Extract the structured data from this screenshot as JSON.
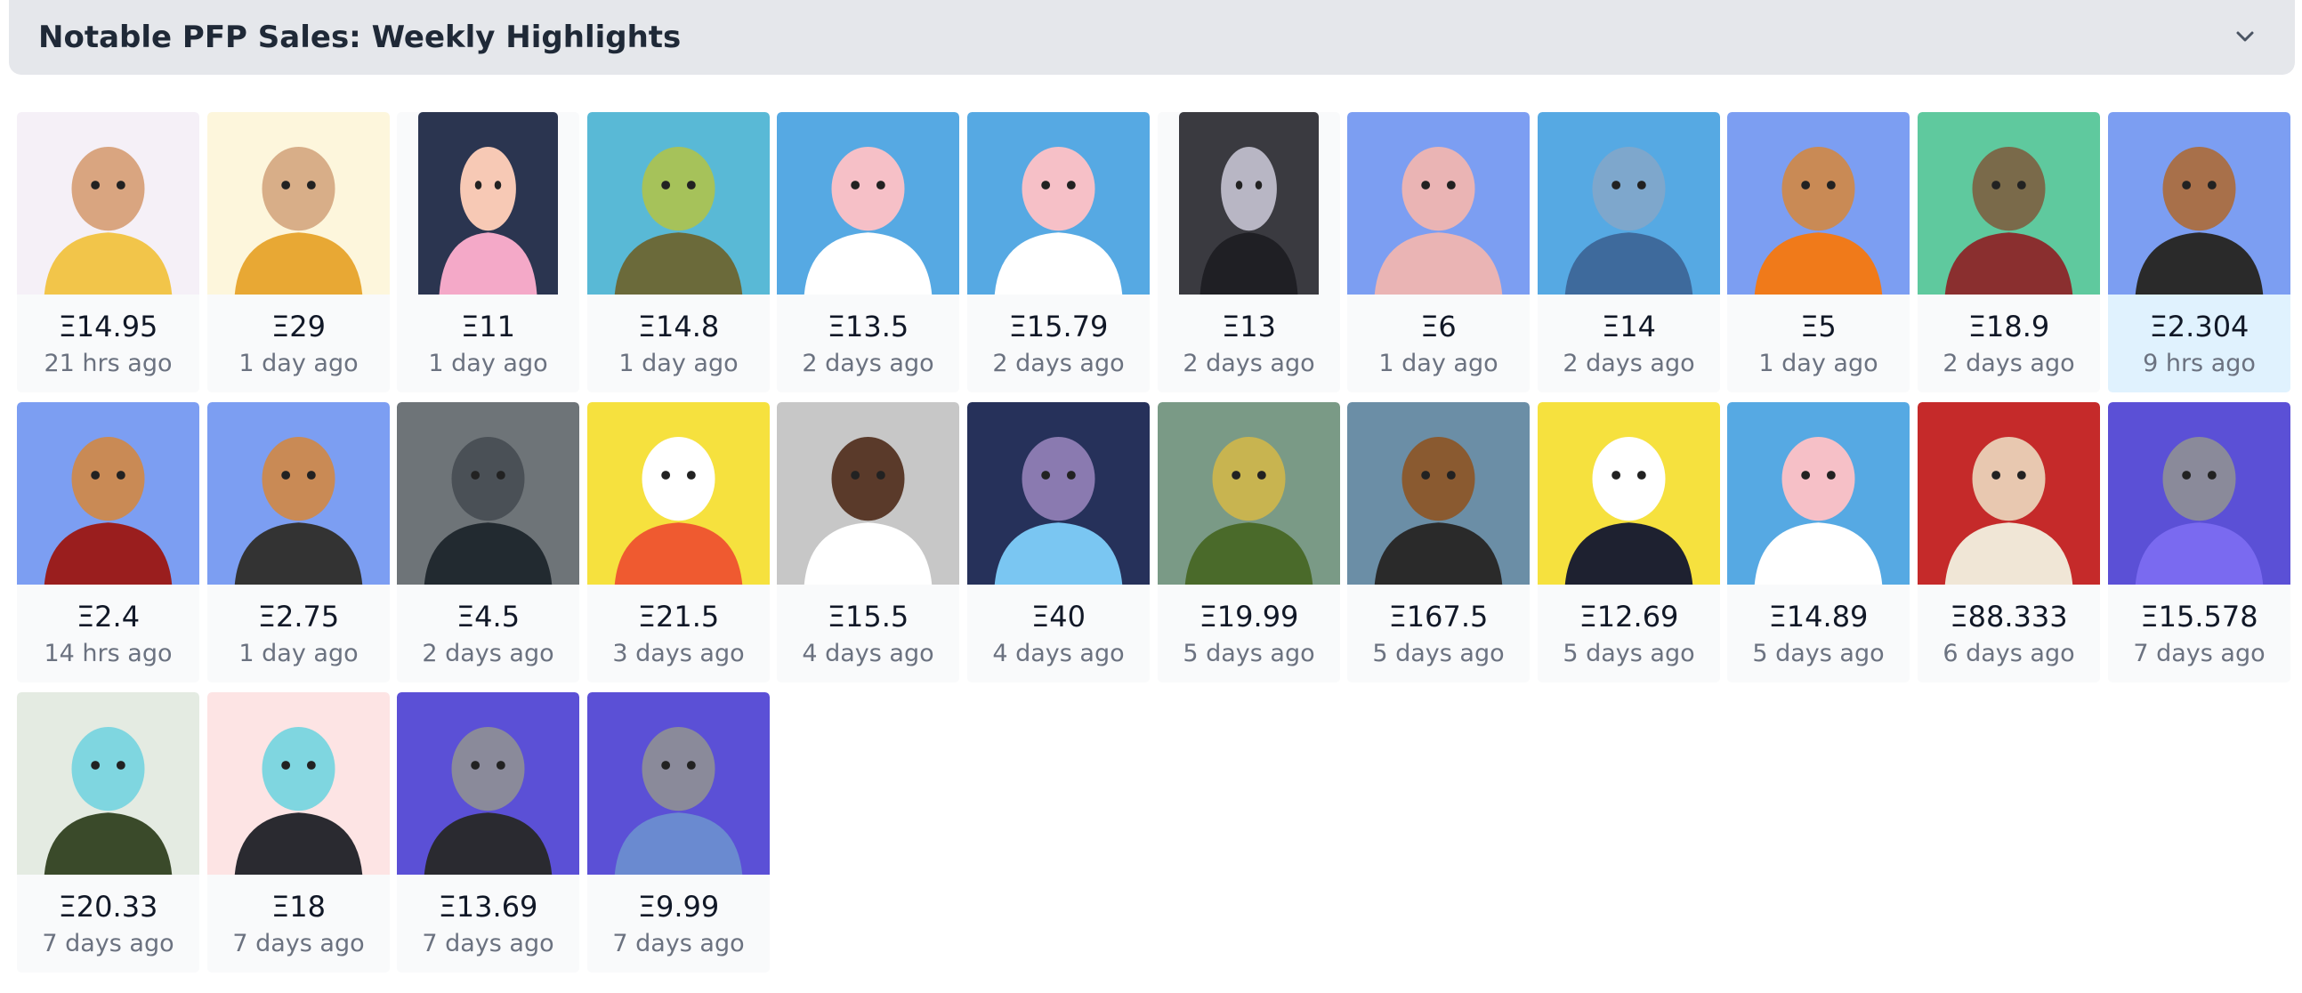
{
  "header": {
    "title": "Notable PFP Sales: Weekly Highlights",
    "toggle_icon": "chevron-down-icon"
  },
  "sales": [
    {
      "price": "Ξ14.95",
      "time": "21 hrs ago",
      "bg": "#f5f0f7",
      "figure": "#f2c54a",
      "skin": "#d9a580"
    },
    {
      "price": "Ξ29",
      "time": "1 day ago",
      "bg": "#fdf6dc",
      "figure": "#e8a834",
      "skin": "#d8ae88"
    },
    {
      "price": "Ξ11",
      "time": "1 day ago",
      "bg": "#2b3550",
      "figure": "#f4a9c8",
      "skin": "#f7c9b5"
    },
    {
      "price": "Ξ14.8",
      "time": "1 day ago",
      "bg": "#59b9d6",
      "figure": "#6b6a3a",
      "skin": "#a6c25a"
    },
    {
      "price": "Ξ13.5",
      "time": "2 days ago",
      "bg": "#56a9e3",
      "figure": "#ffffff",
      "skin": "#f6c0c7"
    },
    {
      "price": "Ξ15.79",
      "time": "2 days ago",
      "bg": "#56a9e3",
      "figure": "#ffffff",
      "skin": "#f6c0c7"
    },
    {
      "price": "Ξ13",
      "time": "2 days ago",
      "bg": "#3a3a40",
      "figure": "#1f1f24",
      "skin": "#b8b6c4"
    },
    {
      "price": "Ξ6",
      "time": "1 day ago",
      "bg": "#7c9ef2",
      "figure": "#eab4b4",
      "skin": "#eab4b4"
    },
    {
      "price": "Ξ14",
      "time": "2 days ago",
      "bg": "#56a9e3",
      "figure": "#3e6a9c",
      "skin": "#7ea7cc"
    },
    {
      "price": "Ξ5",
      "time": "1 day ago",
      "bg": "#7c9ef2",
      "figure": "#f07a1a",
      "skin": "#c98a55"
    },
    {
      "price": "Ξ18.9",
      "time": "2 days ago",
      "bg": "#5fc99e",
      "figure": "#8a2f2f",
      "skin": "#7a6a4a"
    },
    {
      "price": "Ξ2.304",
      "time": "9 hrs ago",
      "bg": "#7c9ef2",
      "figure": "#2a2a2a",
      "skin": "#a8704a"
    },
    {
      "price": "Ξ2.4",
      "time": "14 hrs ago",
      "bg": "#7c9ef2",
      "figure": "#9a1e1e",
      "skin": "#c98a55"
    },
    {
      "price": "Ξ2.75",
      "time": "1 day ago",
      "bg": "#7c9ef2",
      "figure": "#333333",
      "skin": "#c98a55"
    },
    {
      "price": "Ξ4.5",
      "time": "2 days ago",
      "bg": "#6e7478",
      "figure": "#222a30",
      "skin": "#4a5056"
    },
    {
      "price": "Ξ21.5",
      "time": "3 days ago",
      "bg": "#f6e13e",
      "figure": "#ef5a30",
      "skin": "#ffffff"
    },
    {
      "price": "Ξ15.5",
      "time": "4 days ago",
      "bg": "#c7c7c7",
      "figure": "#ffffff",
      "skin": "#5a3a2a"
    },
    {
      "price": "Ξ40",
      "time": "4 days ago",
      "bg": "#26315a",
      "figure": "#7ac6f2",
      "skin": "#8a7ab0"
    },
    {
      "price": "Ξ19.99",
      "time": "5 days ago",
      "bg": "#7a9a86",
      "figure": "#4a6a2a",
      "skin": "#c8b450"
    },
    {
      "price": "Ξ167.5",
      "time": "5 days ago",
      "bg": "#6b8ea6",
      "figure": "#2a2a2a",
      "skin": "#8a5a30"
    },
    {
      "price": "Ξ12.69",
      "time": "5 days ago",
      "bg": "#f6e13e",
      "figure": "#1e2130",
      "skin": "#ffffff"
    },
    {
      "price": "Ξ14.89",
      "time": "5 days ago",
      "bg": "#56a9e3",
      "figure": "#ffffff",
      "skin": "#f6c0c7"
    },
    {
      "price": "Ξ88.333",
      "time": "6 days ago",
      "bg": "#c52a2a",
      "figure": "#f0e6d6",
      "skin": "#e8c8b0"
    },
    {
      "price": "Ξ15.578",
      "time": "7 days ago",
      "bg": "#5b50d6",
      "figure": "#7a6af0",
      "skin": "#8a8a9a"
    },
    {
      "price": "Ξ20.33",
      "time": "7 days ago",
      "bg": "#e4ebe2",
      "figure": "#3a4a2a",
      "skin": "#7fd6e0"
    },
    {
      "price": "Ξ18",
      "time": "7 days ago",
      "bg": "#fde4e4",
      "figure": "#2a2a30",
      "skin": "#7fd6e0"
    },
    {
      "price": "Ξ13.69",
      "time": "7 days ago",
      "bg": "#5b50d6",
      "figure": "#2a2a30",
      "skin": "#8a8a9a"
    },
    {
      "price": "Ξ9.99",
      "time": "7 days ago",
      "bg": "#5b50d6",
      "figure": "#6a8ad0",
      "skin": "#8a8a9a"
    }
  ]
}
